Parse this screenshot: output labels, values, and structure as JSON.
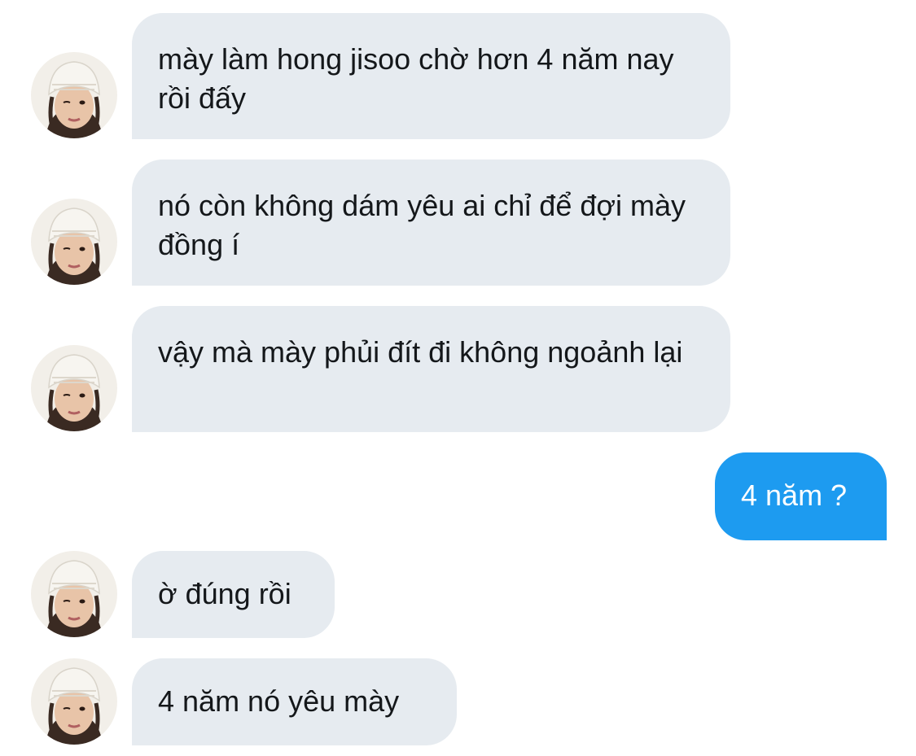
{
  "conversation": {
    "messages": [
      {
        "direction": "incoming",
        "text": "mày làm hong jisoo chờ hơn 4 năm nay rồi đấy"
      },
      {
        "direction": "incoming",
        "text": "nó còn không dám yêu ai chỉ để đợi mày đồng í"
      },
      {
        "direction": "incoming",
        "text": "vậy mà mày phủi đít đi không ngoảnh lại"
      },
      {
        "direction": "outgoing",
        "text": "4 năm ?"
      },
      {
        "direction": "incoming",
        "text": "ờ đúng rồi"
      },
      {
        "direction": "incoming",
        "text": "4 năm nó yêu mày"
      }
    ]
  },
  "colors": {
    "incoming_bubble": "#e6ebf0",
    "outgoing_bubble": "#1d9bf0",
    "incoming_text": "#14171a",
    "outgoing_text": "#ffffff"
  },
  "icons": {
    "avatar": "avatar-photo-person-white-beanie-winking"
  }
}
